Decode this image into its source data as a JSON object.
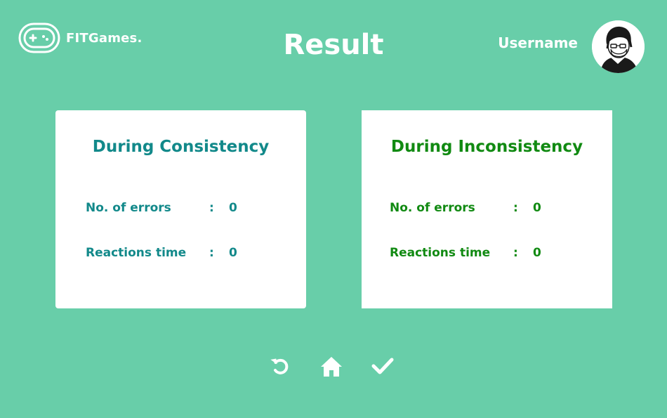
{
  "header": {
    "logo_text": "FITGames.",
    "title": "Result",
    "username": "Username"
  },
  "cards": {
    "consistency": {
      "title": "During Consistency",
      "errors_label": "No. of errors",
      "errors_sep": ":",
      "errors_value": "0",
      "reaction_label": "Reactions time",
      "reaction_sep": ":",
      "reaction_value": "0"
    },
    "inconsistency": {
      "title": "During Inconsistency",
      "errors_label": "No. of errors",
      "errors_sep": ":",
      "errors_value": "0",
      "reaction_label": "Reactions time",
      "reaction_sep": ":",
      "reaction_value": "0"
    }
  },
  "actions": [
    {
      "icon": "retry-icon"
    },
    {
      "icon": "home-icon"
    },
    {
      "icon": "checkmark-icon"
    }
  ],
  "colors": {
    "background": "#68cea9",
    "consistency_text": "#12898a",
    "inconsistency_text": "#118a12",
    "card": "#ffffff"
  }
}
